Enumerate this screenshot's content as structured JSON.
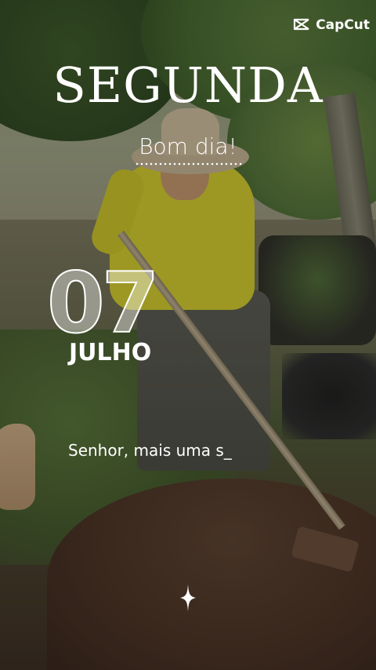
{
  "brand": {
    "name": "CapCut",
    "icon": "capcut-logo-icon"
  },
  "overlay": {
    "weekday": "SEGUNDA",
    "greeting": "Bom dia!",
    "day": "07",
    "month": "JULHO",
    "message": "Senhor, mais uma s_"
  },
  "decorations": {
    "sparkle_icon": "sparkle-icon",
    "divider": "dotted-divider"
  },
  "colors": {
    "text": "#ffffff",
    "shirt": "#d8d12e",
    "foliage": "#476a30"
  }
}
